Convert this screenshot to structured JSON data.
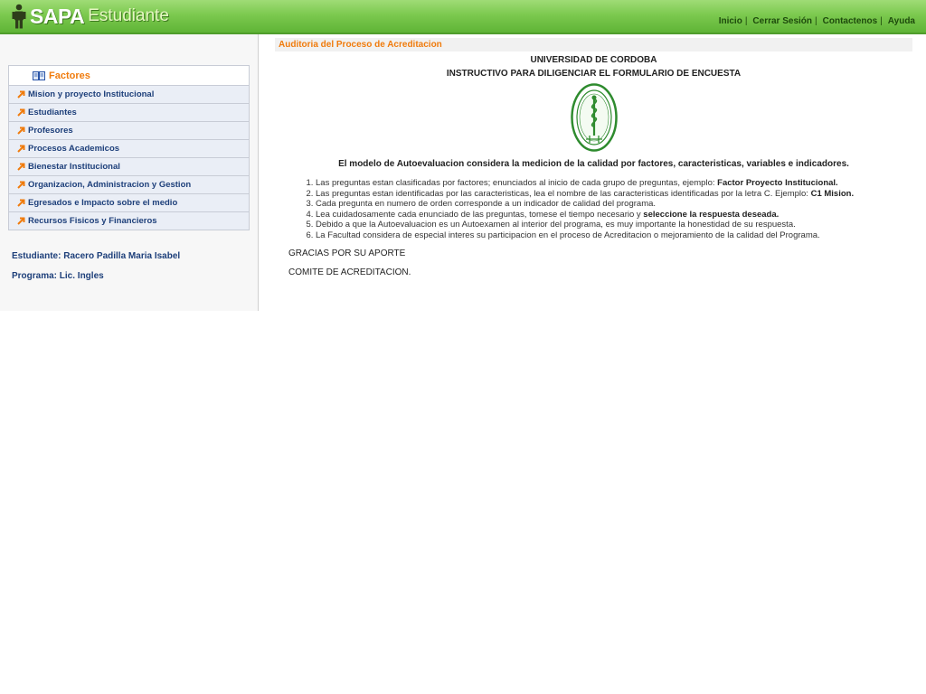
{
  "header": {
    "logo_primary": "SAPA",
    "logo_secondary": "Estudiante",
    "nav": [
      {
        "label": "Inicio"
      },
      {
        "label": "Cerrar Sesión"
      },
      {
        "label": "Contactenos"
      },
      {
        "label": "Ayuda"
      }
    ],
    "separator": "|"
  },
  "sidebar": {
    "heading": "Factores",
    "items": [
      {
        "label": "Mision y proyecto Institucional"
      },
      {
        "label": "Estudiantes"
      },
      {
        "label": "Profesores"
      },
      {
        "label": "Procesos Academicos"
      },
      {
        "label": "Bienestar Institucional"
      },
      {
        "label": "Organizacion, Administracion y Gestion"
      },
      {
        "label": "Egresados e Impacto sobre el medio"
      },
      {
        "label": "Recursos Fisicos y Financieros"
      }
    ],
    "student": "Estudiante: Racero Padilla Maria Isabel",
    "program": "Programa: Lic. Ingles"
  },
  "main": {
    "section_title": "Auditoria del Proceso de Acreditacion",
    "university": "UNIVERSIDAD DE CORDOBA",
    "instructive_title": "INSTRUCTIVO PARA DILIGENCIAR EL FORMULARIO DE ENCUESTA",
    "intro": "El modelo de Autoevaluacion considera la medicion de la calidad por factores, caracteristicas, variables e indicadores.",
    "instructions": [
      {
        "text": "Las preguntas estan clasificadas por factores; enunciados al inicio de cada grupo de preguntas, ejemplo: ",
        "bold": "Factor Proyecto Institucional."
      },
      {
        "text": "Las preguntas estan identificadas por las caracteristicas, lea el nombre de las caracteristicas identificadas por la letra C. Ejemplo: ",
        "bold": "C1 Mision."
      },
      {
        "text": "Cada pregunta en numero de orden corresponde a un indicador de calidad del programa.",
        "bold": ""
      },
      {
        "text": "Lea cuidadosamente cada enunciado de las preguntas, tomese el tiempo necesario y ",
        "bold": "seleccione la respuesta deseada."
      },
      {
        "text": "Debido a que la Autoevaluacion es un Autoexamen al interior del programa, es muy importante la honestidad de su respuesta.",
        "bold": ""
      },
      {
        "text": "La Facultad considera de especial interes su participacion en el proceso de Acreditacion o mejoramiento de la calidad del Programa.",
        "bold": ""
      }
    ],
    "thanks": "GRACIAS POR SU APORTE",
    "committee": "COMITE DE ACREDITACION."
  },
  "colors": {
    "header_green": "#7cc94f",
    "accent_orange": "#f07b0c",
    "link_blue": "#1d3f7a",
    "menu_bg": "#eaeef6",
    "seal_green": "#2e8b2e"
  },
  "icons": {
    "logo": "person-figure-icon",
    "factors": "book-icon",
    "menu": "orange-arrow-icon",
    "seal": "university-seal-icon"
  }
}
